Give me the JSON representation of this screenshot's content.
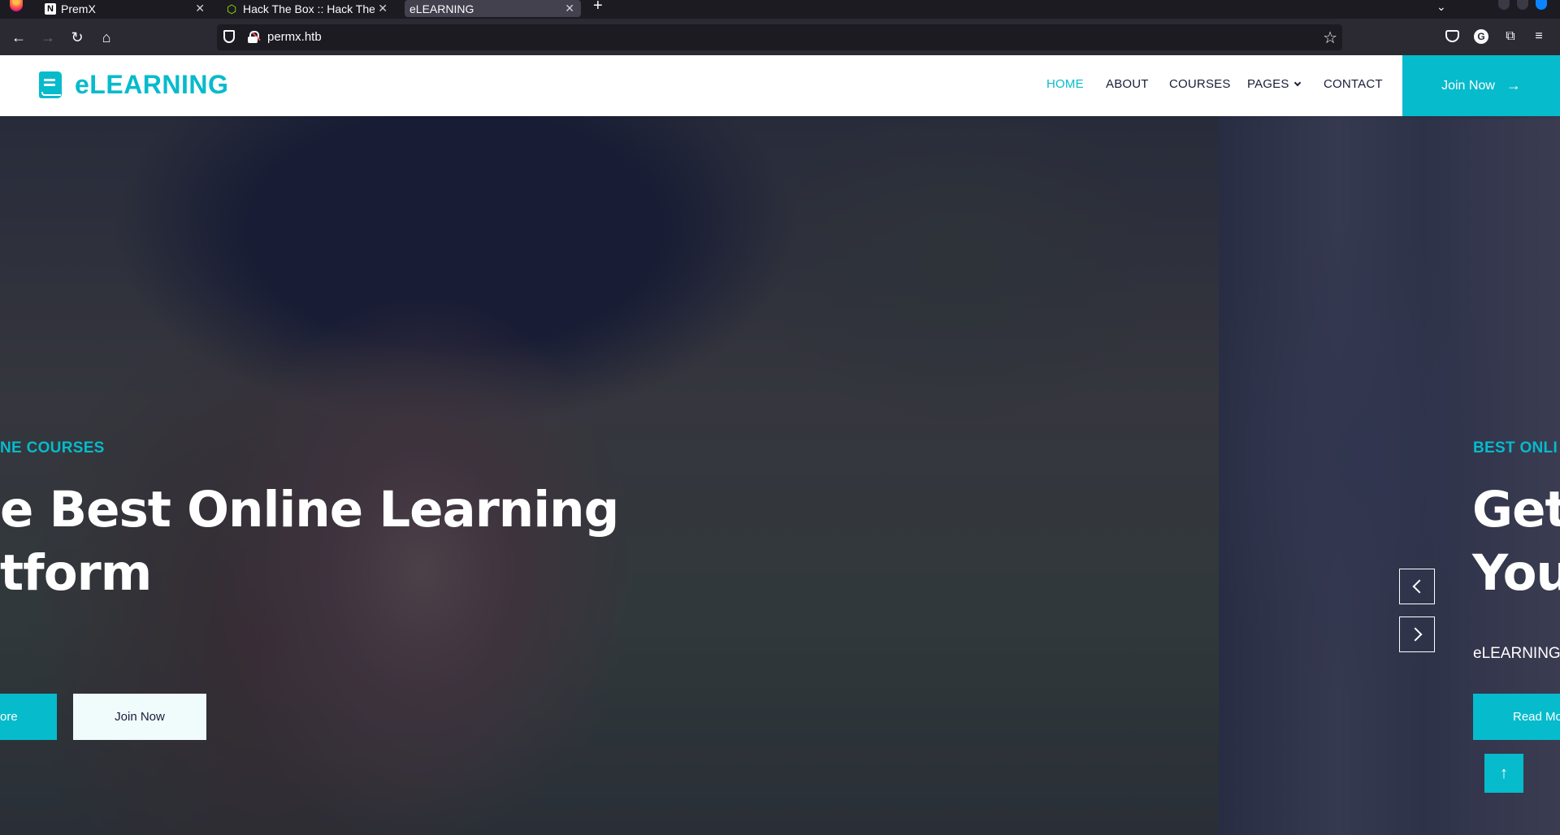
{
  "browser": {
    "tabs": [
      {
        "title": "PremX",
        "active": false
      },
      {
        "title": "Hack The Box :: Hack The",
        "active": false
      },
      {
        "title": "eLEARNING",
        "active": true
      }
    ],
    "url": "permx.htb"
  },
  "site": {
    "brand": "eLEARNING",
    "menu": [
      "HOME",
      "ABOUT",
      "COURSES",
      "PAGES",
      "CONTACT"
    ],
    "active_menu": "HOME",
    "cta_label": "Join Now",
    "accent_color": "#06bbcc",
    "dark_color": "#181d38"
  },
  "hero": {
    "slide1": {
      "kicker": "NE COURSES",
      "headline_line1": "e Best Online Learning",
      "headline_line2": "tform",
      "btn_primary": "ore",
      "btn_secondary": "Join Now"
    },
    "slide2": {
      "kicker": "BEST ONLI",
      "headline_line1": "Get",
      "headline_line2": "You",
      "subline": "eLEARNING",
      "btn_primary": "Read Mo"
    }
  }
}
